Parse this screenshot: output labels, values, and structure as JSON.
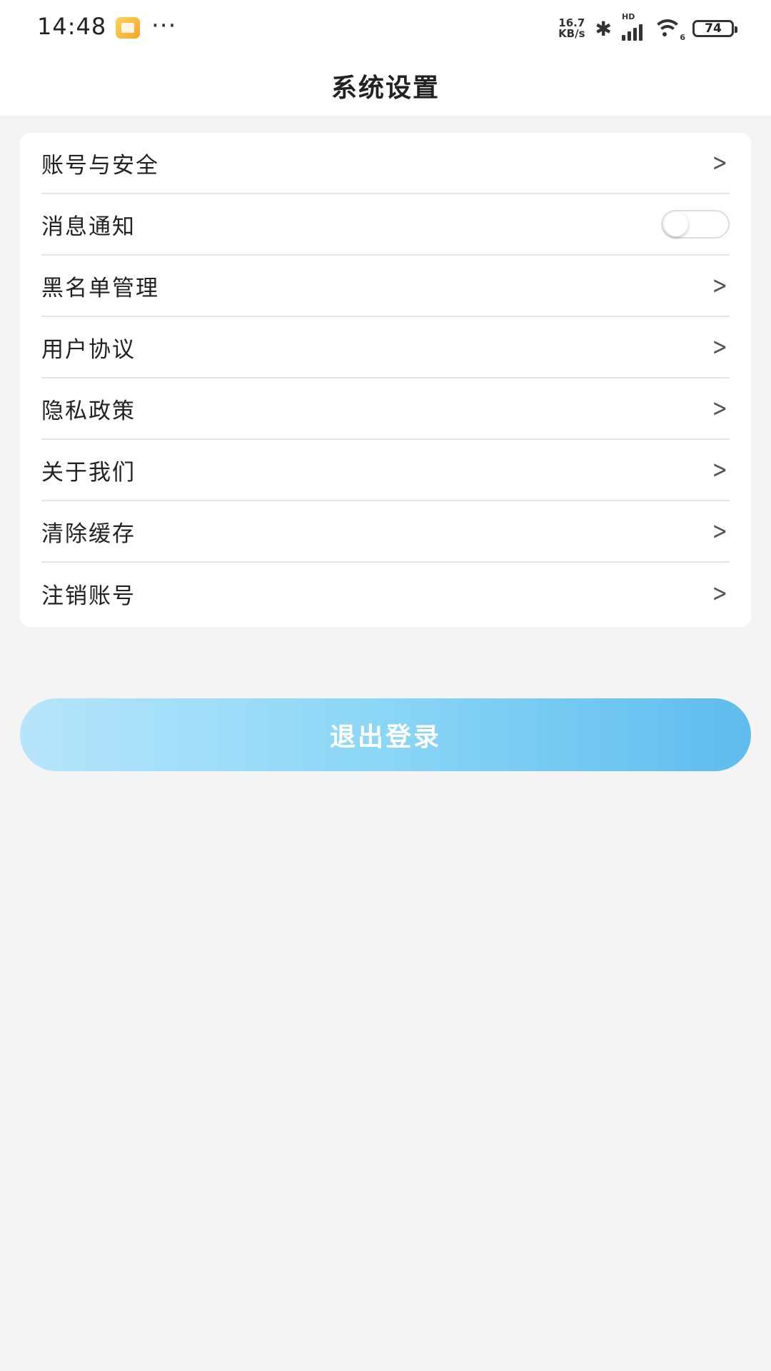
{
  "status_bar": {
    "time": "14:48",
    "more": "···",
    "net_speed_value": "16.7",
    "net_speed_unit": "KB/s",
    "signal_label": "HD",
    "wifi_label": "6",
    "battery": "74"
  },
  "header": {
    "title": "系统设置"
  },
  "settings": {
    "items": [
      {
        "label": "账号与安全",
        "control": "chevron"
      },
      {
        "label": "消息通知",
        "control": "toggle",
        "enabled": false
      },
      {
        "label": "黑名单管理",
        "control": "chevron"
      },
      {
        "label": "用户协议",
        "control": "chevron"
      },
      {
        "label": "隐私政策",
        "control": "chevron"
      },
      {
        "label": "关于我们",
        "control": "chevron"
      },
      {
        "label": "清除缓存",
        "control": "chevron"
      },
      {
        "label": "注销账号",
        "control": "chevron"
      }
    ]
  },
  "logout": {
    "label": "退出登录"
  },
  "colors": {
    "background": "#f4f4f5",
    "card": "#ffffff",
    "button_gradient_start": "#b7e5fb",
    "button_gradient_end": "#5fbcee"
  },
  "icons": {
    "chevron": "chevron-right-icon",
    "toggle": "toggle-switch"
  }
}
